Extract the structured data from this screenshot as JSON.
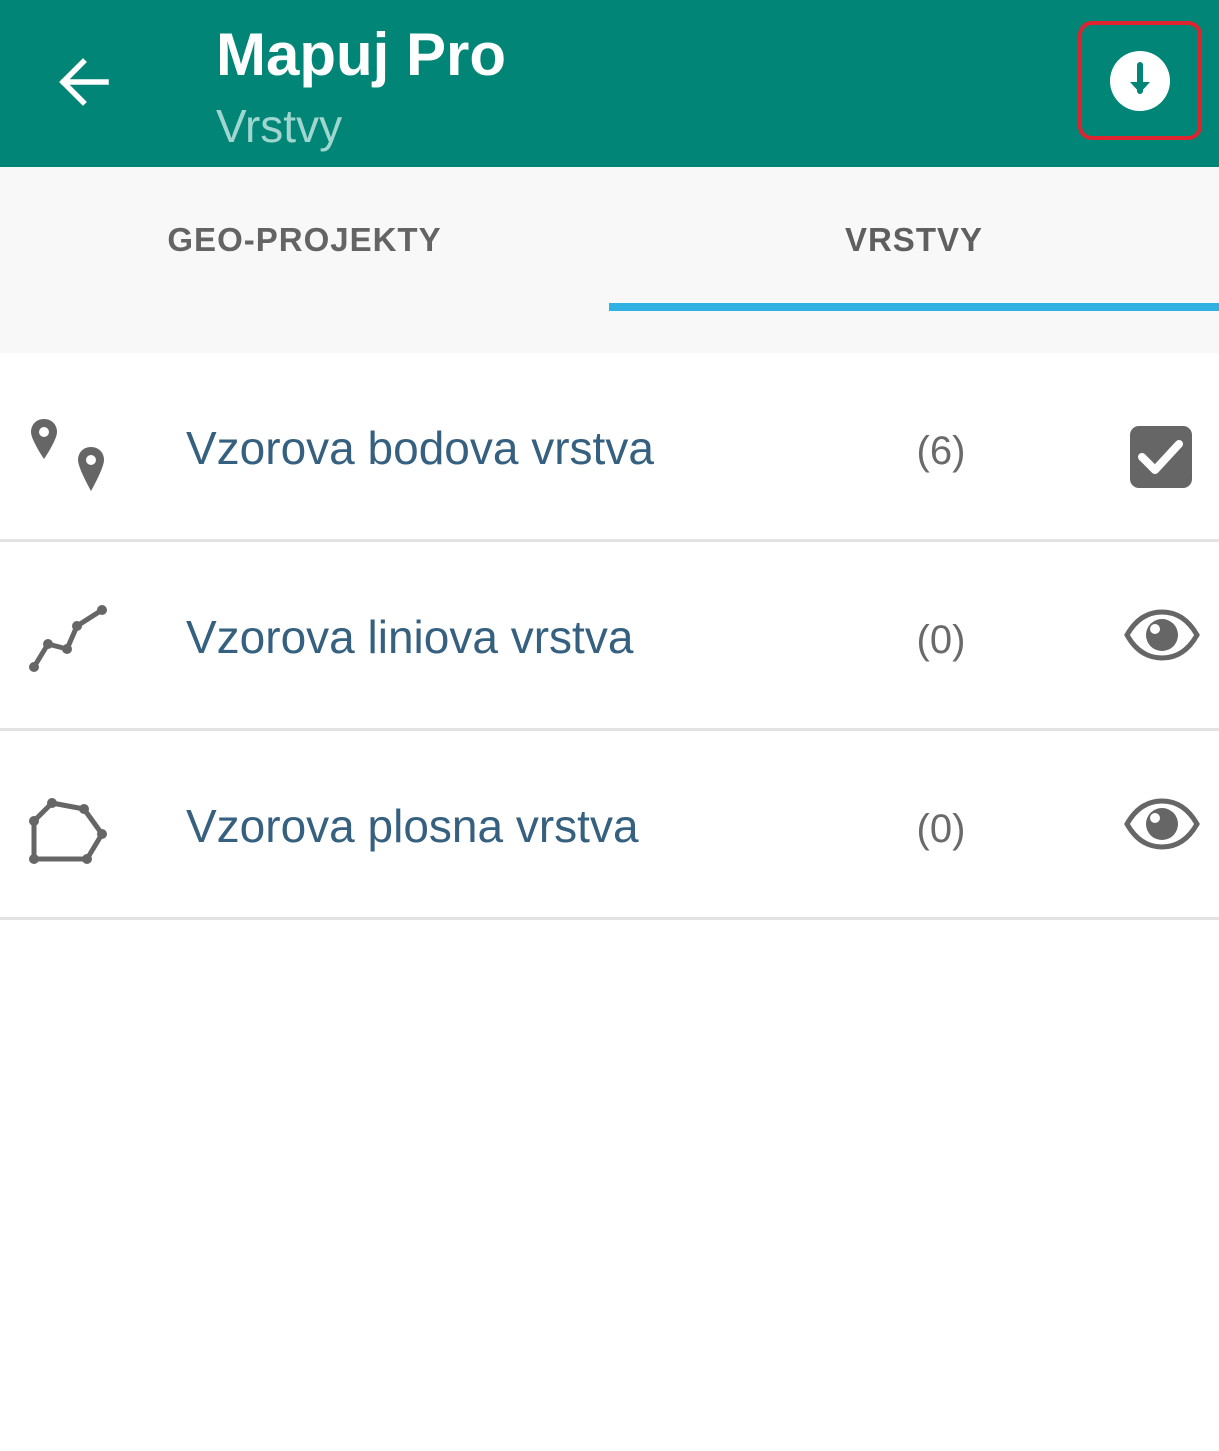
{
  "appbar": {
    "title": "Mapuj Pro",
    "subtitle": "Vrstvy",
    "background_color": "#008577",
    "back_icon": "arrow-left-icon",
    "download_icon": "download-circle-icon",
    "highlight_color": "#e0242f"
  },
  "tabs": [
    {
      "label": "GEO-PROJEKTY",
      "selected": false
    },
    {
      "label": "VRSTVY",
      "selected": true
    }
  ],
  "tab_indicator_color": "#2fb1e3",
  "layers": [
    {
      "name": "Vzorova bodova vrstva",
      "count": "(6)",
      "type_icon": "point-layer-icon",
      "action_icon": "checkbox-checked-icon"
    },
    {
      "name": "Vzorova liniova vrstva",
      "count": "(0)",
      "type_icon": "line-layer-icon",
      "action_icon": "eye-icon"
    },
    {
      "name": "Vzorova plosna vrstva",
      "count": "(0)",
      "type_icon": "polygon-layer-icon",
      "action_icon": "eye-icon"
    }
  ]
}
